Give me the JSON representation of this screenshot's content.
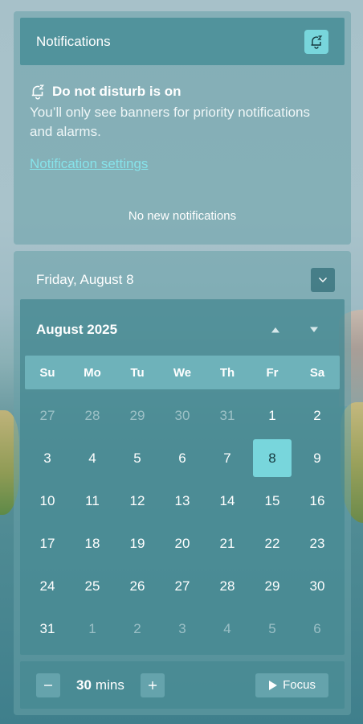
{
  "notifications": {
    "title": "Notifications",
    "dnd_title": "Do not disturb is on",
    "dnd_description": "You’ll only see banners for priority notifications and alarms.",
    "settings_link": "Notification settings",
    "empty_text": "No new notifications"
  },
  "calendar": {
    "date_header": "Friday, August 8",
    "month_title": "August 2025",
    "weekdays": [
      "Su",
      "Mo",
      "Tu",
      "We",
      "Th",
      "Fr",
      "Sa"
    ],
    "days": [
      {
        "label": "27",
        "muted": true
      },
      {
        "label": "28",
        "muted": true
      },
      {
        "label": "29",
        "muted": true
      },
      {
        "label": "30",
        "muted": true
      },
      {
        "label": "31",
        "muted": true
      },
      {
        "label": "1"
      },
      {
        "label": "2"
      },
      {
        "label": "3"
      },
      {
        "label": "4"
      },
      {
        "label": "5"
      },
      {
        "label": "6"
      },
      {
        "label": "7"
      },
      {
        "label": "8",
        "today": true
      },
      {
        "label": "9"
      },
      {
        "label": "10"
      },
      {
        "label": "11"
      },
      {
        "label": "12"
      },
      {
        "label": "13"
      },
      {
        "label": "14"
      },
      {
        "label": "15"
      },
      {
        "label": "16"
      },
      {
        "label": "17"
      },
      {
        "label": "18"
      },
      {
        "label": "19"
      },
      {
        "label": "20"
      },
      {
        "label": "21"
      },
      {
        "label": "22"
      },
      {
        "label": "23"
      },
      {
        "label": "24"
      },
      {
        "label": "25"
      },
      {
        "label": "26"
      },
      {
        "label": "27"
      },
      {
        "label": "28"
      },
      {
        "label": "29"
      },
      {
        "label": "30"
      },
      {
        "label": "31"
      },
      {
        "label": "1",
        "muted": true
      },
      {
        "label": "2",
        "muted": true
      },
      {
        "label": "3",
        "muted": true
      },
      {
        "label": "4",
        "muted": true
      },
      {
        "label": "5",
        "muted": true
      },
      {
        "label": "6",
        "muted": true
      }
    ]
  },
  "focus": {
    "duration_value": "30",
    "duration_unit": "mins",
    "focus_label": "Focus"
  },
  "icons": {
    "dnd": "bell-snooze-icon",
    "collapse": "chevron-down-icon",
    "prev_month": "triangle-up-icon",
    "next_month": "triangle-down-icon",
    "decrease": "minus-icon",
    "increase": "plus-icon",
    "play": "play-icon"
  },
  "colors": {
    "accent": "#78d6dc",
    "link": "#86e3ea"
  }
}
